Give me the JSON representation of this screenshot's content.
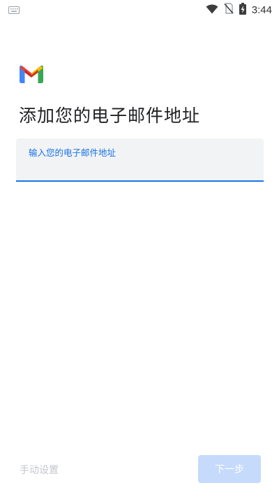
{
  "status_bar": {
    "time": "3:44",
    "icons": [
      "keyboard-icon",
      "wifi-icon",
      "no-sim-icon",
      "battery-charging-icon"
    ]
  },
  "app": {
    "logo": "gmail-logo-icon",
    "title": "添加您的电子邮件地址"
  },
  "email_field": {
    "label": "输入您的电子邮件地址",
    "value": ""
  },
  "actions": {
    "manual_setup_label": "手动设置",
    "next_label": "下一步"
  },
  "colors": {
    "accent": "#1a73e8",
    "field_bg": "#f1f3f4",
    "next_disabled_bg": "#c6dafb",
    "disabled_text": "#c4c7cc"
  }
}
